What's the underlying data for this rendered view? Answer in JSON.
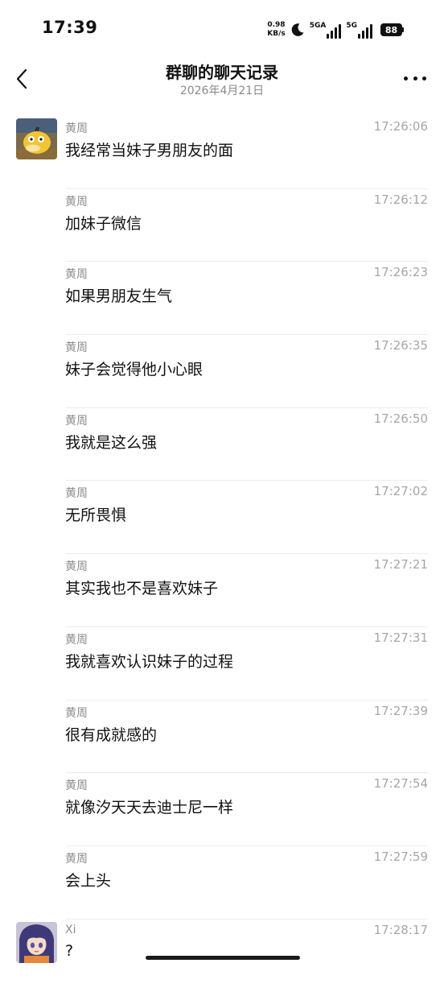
{
  "status_bar": {
    "time": "17:39",
    "net_speed_value": "0.98",
    "net_speed_unit": "KB/s",
    "signal1_label": "5GA",
    "signal2_label": "5G",
    "battery": "88"
  },
  "header": {
    "title": "群聊的聊天记录",
    "subtitle": "2026年4月21日"
  },
  "messages": [
    {
      "sender": "黄周",
      "time": "17:26:06",
      "text": "我经常当妹子男朋友的面",
      "avatar": "psyduck"
    },
    {
      "sender": "黄周",
      "time": "17:26:12",
      "text": "加妹子微信"
    },
    {
      "sender": "黄周",
      "time": "17:26:23",
      "text": "如果男朋友生气"
    },
    {
      "sender": "黄周",
      "time": "17:26:35",
      "text": "妹子会觉得他小心眼"
    },
    {
      "sender": "黄周",
      "time": "17:26:50",
      "text": "我就是这么强"
    },
    {
      "sender": "黄周",
      "time": "17:27:02",
      "text": "无所畏惧"
    },
    {
      "sender": "黄周",
      "time": "17:27:21",
      "text": "其实我也不是喜欢妹子"
    },
    {
      "sender": "黄周",
      "time": "17:27:31",
      "text": "我就喜欢认识妹子的过程"
    },
    {
      "sender": "黄周",
      "time": "17:27:39",
      "text": "很有成就感的"
    },
    {
      "sender": "黄周",
      "time": "17:27:54",
      "text": "就像汐天天去迪士尼一样"
    },
    {
      "sender": "黄周",
      "time": "17:27:59",
      "text": "会上头"
    },
    {
      "sender": "Xi",
      "time": "17:28:17",
      "text": "?",
      "avatar": "anime-girl"
    }
  ],
  "colors": {
    "muted_text": "#8c8c8c",
    "time_text": "#a6a6a6",
    "divider": "#ececec"
  }
}
